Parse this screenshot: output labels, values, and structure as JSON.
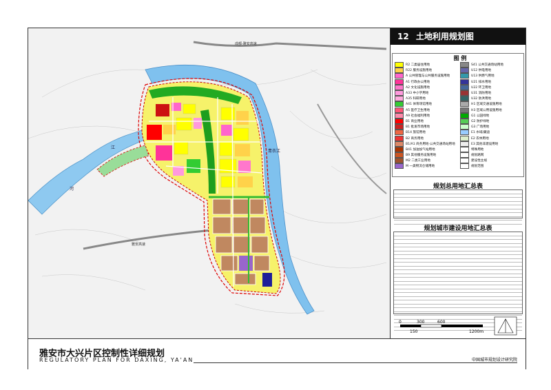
{
  "title": {
    "number": "12",
    "name": "土地利用规划图"
  },
  "legend": {
    "heading": "图 例",
    "left": [
      {
        "code": "R2",
        "label": "二类居住用地",
        "color": "#ffff00"
      },
      {
        "code": "R22",
        "label": "服务设施用地",
        "color": "#ffd24a"
      },
      {
        "code": "A",
        "label": "公共管理与公共服务设施用地",
        "color": "#ff66cc"
      },
      {
        "code": "A1",
        "label": "行政办公用地",
        "color": "#ff3399"
      },
      {
        "code": "A2",
        "label": "文化设施用地",
        "color": "#ff77cc"
      },
      {
        "code": "A33",
        "label": "中小学用地",
        "color": "#ff99dd"
      },
      {
        "code": "A35",
        "label": "科研用地",
        "color": "#ffaadd"
      },
      {
        "code": "A41",
        "label": "体育场馆用地",
        "color": "#33cc33"
      },
      {
        "code": "A5",
        "label": "医疗卫生用地",
        "color": "#ff5577"
      },
      {
        "code": "A9",
        "label": "社会福利用地",
        "color": "#ff88aa"
      },
      {
        "code": "B1",
        "label": "商业用地",
        "color": "#ff0000"
      },
      {
        "code": "B1",
        "label": "批发市场用地",
        "color": "#cc2222"
      },
      {
        "code": "B14",
        "label": "旅馆用地",
        "color": "#ee6644"
      },
      {
        "code": "B2",
        "label": "商务用地",
        "color": "#ee3333"
      },
      {
        "code": "B1/A1",
        "label": "商务用地·公共交通场站用地",
        "color": "#dd8866"
      },
      {
        "code": "B41",
        "label": "加油加气站用地",
        "color": "#aa3300"
      },
      {
        "code": "B9",
        "label": "其他服务设施用地",
        "color": "#cc5522"
      },
      {
        "code": "M2",
        "label": "二类工业用地",
        "color": "#a0522d"
      },
      {
        "code": "M",
        "label": "一类物流仓储用地",
        "color": "#9966cc"
      }
    ],
    "right": [
      {
        "code": "S41",
        "label": "公共交通场站用地",
        "color": "#888888"
      },
      {
        "code": "U12",
        "label": "供电用地",
        "color": "#6666aa"
      },
      {
        "code": "U13",
        "label": "供燃气用地",
        "color": "#3399aa"
      },
      {
        "code": "U21",
        "label": "排水用地",
        "color": "#333399"
      },
      {
        "code": "U22",
        "label": "环卫用地",
        "color": "#446699"
      },
      {
        "code": "U31",
        "label": "消防用地",
        "color": "#993333"
      },
      {
        "code": "U32",
        "label": "防洪用地",
        "color": "#336666"
      },
      {
        "code": "H1",
        "label": "区域交通设施用地",
        "color": "#aaaaaa"
      },
      {
        "code": "H3",
        "label": "区域公用设施用地",
        "color": "#777777"
      },
      {
        "code": "G1",
        "label": "公园绿地",
        "color": "#00aa00"
      },
      {
        "code": "G2",
        "label": "防护绿地",
        "color": "#55cc55"
      },
      {
        "code": "G3",
        "label": "广场用地",
        "color": "#ccffcc"
      },
      {
        "code": "E1",
        "label": "水域/藏迪",
        "color": "#99ccff"
      },
      {
        "code": "E2",
        "label": "农林用地",
        "color": "#ddeecc"
      },
      {
        "code": "E3",
        "label": "其他非建设用地",
        "color": "#eeeeee"
      },
      {
        "code": "",
        "label": "特殊用地",
        "color": "#ffffff"
      },
      {
        "code": "",
        "label": "规划路网",
        "color": "#ffffff"
      },
      {
        "code": "",
        "label": "建设性主线",
        "color": "#ffffff"
      },
      {
        "code": "",
        "label": "规划范围",
        "color": "#ffffff"
      }
    ]
  },
  "summary_tables": [
    {
      "heading": "规划总用地汇总表",
      "rows": 9
    },
    {
      "heading": "规划城市建设用地汇总表",
      "rows": 40
    }
  ],
  "map_labels": [
    "成都-雅安高速",
    "成都-雅安高速",
    "雅安高速",
    "青衣江",
    "河",
    "江",
    "江"
  ],
  "footer": {
    "title_cn": "雅安市大兴片区控制性详细规划",
    "title_en": "REGULATORY  PLAN FOR DAXING, YA'AN",
    "institute": "中国城市规划设计研究院"
  },
  "scale_bar": {
    "ticks": [
      "0",
      "300",
      "600"
    ],
    "sub": [
      "150",
      "1200m"
    ]
  }
}
